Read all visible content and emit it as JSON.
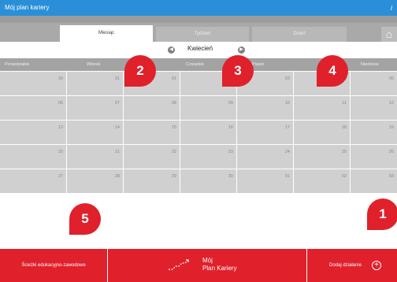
{
  "window": {
    "title": "Mój plan kariery",
    "info_glyph": "i"
  },
  "tabs": [
    {
      "label": "Miesiąc",
      "active": true
    },
    {
      "label": "Tydzień",
      "active": false
    },
    {
      "label": "Dzień",
      "active": false
    }
  ],
  "month_label": "Kwiecień",
  "weekdays": [
    "Poniedziałek",
    "Wtorek",
    "Środa",
    "Czwartek",
    "Piątek",
    "Sobota",
    "Niedziela"
  ],
  "weeks": [
    [
      "30",
      "31",
      "01",
      "02",
      "03",
      "04",
      "05"
    ],
    [
      "06",
      "07",
      "08",
      "09",
      "10",
      "11",
      "12"
    ],
    [
      "13",
      "14",
      "15",
      "16",
      "17",
      "18",
      "19"
    ],
    [
      "20",
      "21",
      "22",
      "23",
      "24",
      "25",
      "26"
    ],
    [
      "27",
      "28",
      "29",
      "30",
      "01",
      "02",
      "03"
    ]
  ],
  "badges": [
    "1",
    "2",
    "3",
    "4",
    "5"
  ],
  "bottom": {
    "paths_label": "Ścieżki edukacyjno-zawodowe",
    "plan_line1": "Mój",
    "plan_line2": "Plan Kariery",
    "add_label": "Dodaj działanie"
  },
  "colors": {
    "accent": "#e0202b",
    "titlebar": "#2a8fd8"
  }
}
